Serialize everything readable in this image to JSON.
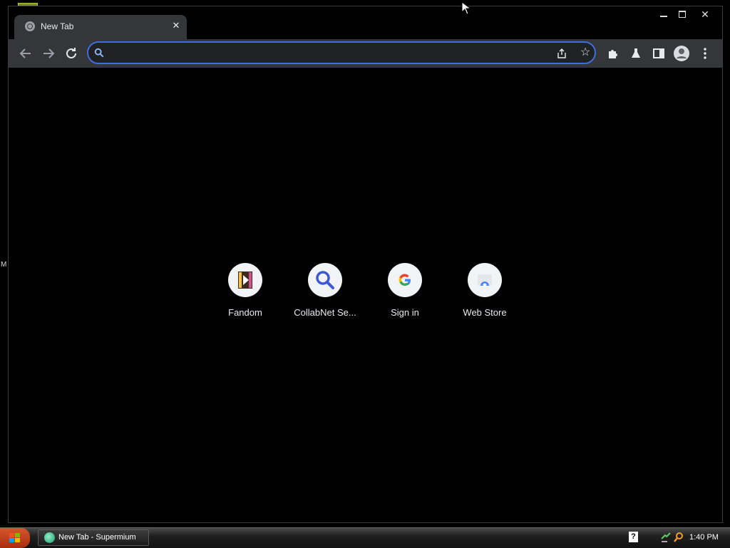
{
  "browser": {
    "tab": {
      "title": "New Tab",
      "close_glyph": "✕"
    },
    "window_controls": {
      "close_glyph": "✕"
    },
    "toolbar": {
      "omnibox": {
        "value": "",
        "placeholder": ""
      }
    }
  },
  "new_tab": {
    "shortcuts": [
      {
        "label": "Fandom",
        "icon": "fandom-icon"
      },
      {
        "label": "CollabNet Se...",
        "icon": "search-icon"
      },
      {
        "label": "Sign in",
        "icon": "google-icon"
      },
      {
        "label": "Web Store",
        "icon": "web-store-icon"
      }
    ]
  },
  "desktop": {
    "side_letter": "M"
  },
  "taskbar": {
    "task_label": "New Tab - Supermium",
    "clock": "1:40 PM",
    "help_glyph": "?"
  },
  "colors": {
    "accent": "#3f6fd8",
    "toolbar_bg": "#35363a",
    "page_bg": "#000000"
  }
}
